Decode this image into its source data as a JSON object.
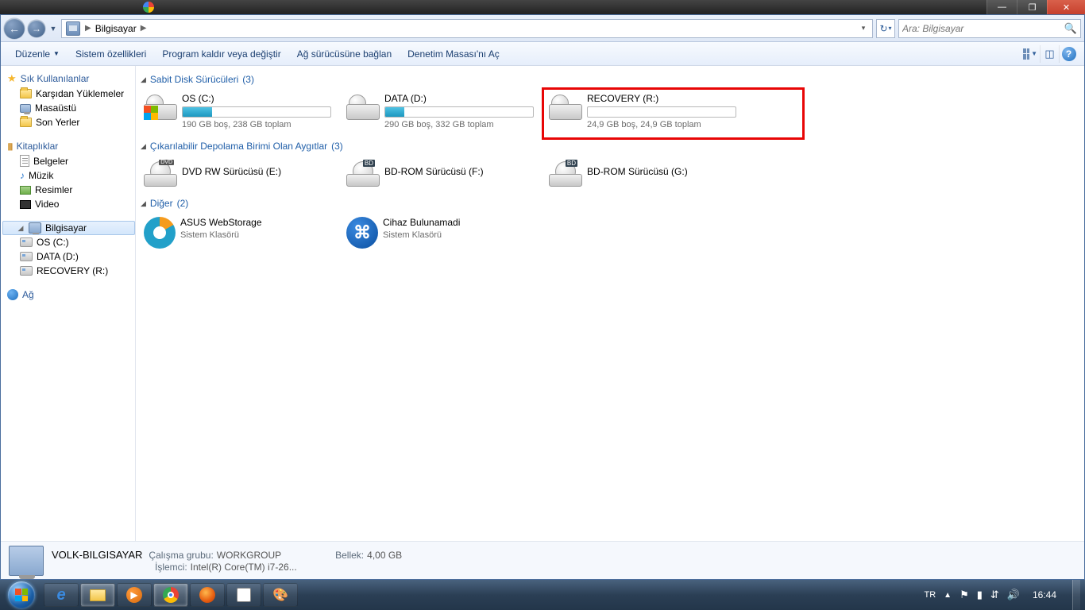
{
  "window_controls": {
    "min": "—",
    "max": "❐",
    "close": "✕"
  },
  "breadcrumb": {
    "root_arrow": "▶",
    "location": "Bilgisayar",
    "sep": "▶"
  },
  "search": {
    "placeholder": "Ara: Bilgisayar"
  },
  "toolbar": {
    "organize": "Düzenle",
    "sysprops": "Sistem özellikleri",
    "uninstall": "Program kaldır veya değiştir",
    "mapdrive": "Ağ sürücüsüne bağlan",
    "controlpanel": "Denetim Masası'nı Aç"
  },
  "nav": {
    "favorites": {
      "title": "Sık Kullanılanlar",
      "items": [
        "Karşıdan Yüklemeler",
        "Masaüstü",
        "Son Yerler"
      ]
    },
    "libraries": {
      "title": "Kitaplıklar",
      "items": [
        "Belgeler",
        "Müzik",
        "Resimler",
        "Video"
      ]
    },
    "computer": {
      "title": "Bilgisayar",
      "items": [
        "OS (C:)",
        "DATA (D:)",
        "RECOVERY (R:)"
      ]
    },
    "network": {
      "title": "Ağ"
    }
  },
  "groups": {
    "hdd": {
      "title": "Sabit Disk Sürücüleri",
      "count": "(3)",
      "drives": [
        {
          "name": "OS (C:)",
          "sub": "190 GB boş, 238 GB toplam",
          "fill": 20
        },
        {
          "name": "DATA (D:)",
          "sub": "290 GB boş, 332 GB toplam",
          "fill": 13
        },
        {
          "name": "RECOVERY (R:)",
          "sub": "24,9 GB boş, 24,9 GB toplam",
          "fill": 0
        }
      ]
    },
    "removable": {
      "title": "Çıkarılabilir Depolama Birimi Olan Aygıtlar",
      "count": "(3)",
      "drives": [
        {
          "name": "DVD RW Sürücüsü (E:)"
        },
        {
          "name": "BD-ROM Sürücüsü (F:)"
        },
        {
          "name": "BD-ROM Sürücüsü (G:)"
        }
      ]
    },
    "other": {
      "title": "Diğer",
      "count": "(2)",
      "items": [
        {
          "name": "ASUS WebStorage",
          "sub": "Sistem Klasörü"
        },
        {
          "name": "Cihaz Bulunamadi",
          "sub": "Sistem Klasörü"
        }
      ]
    }
  },
  "details": {
    "name": "VOLK-BILGISAYAR",
    "workgroup_k": "Çalışma grubu:",
    "workgroup_v": "WORKGROUP",
    "cpu_k": "İşlemci:",
    "cpu_v": "Intel(R) Core(TM) i7-26...",
    "mem_k": "Bellek:",
    "mem_v": "4,00 GB"
  },
  "taskbar": {
    "lang": "TR",
    "time": "16:44"
  }
}
